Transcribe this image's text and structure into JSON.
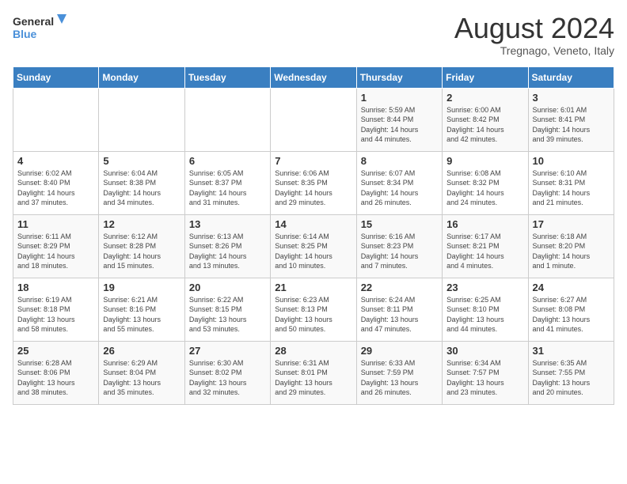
{
  "logo": {
    "line1": "General",
    "line2": "Blue"
  },
  "title": "August 2024",
  "subtitle": "Tregnago, Veneto, Italy",
  "days_of_week": [
    "Sunday",
    "Monday",
    "Tuesday",
    "Wednesday",
    "Thursday",
    "Friday",
    "Saturday"
  ],
  "weeks": [
    [
      {
        "day": "",
        "info": ""
      },
      {
        "day": "",
        "info": ""
      },
      {
        "day": "",
        "info": ""
      },
      {
        "day": "",
        "info": ""
      },
      {
        "day": "1",
        "info": "Sunrise: 5:59 AM\nSunset: 8:44 PM\nDaylight: 14 hours\nand 44 minutes."
      },
      {
        "day": "2",
        "info": "Sunrise: 6:00 AM\nSunset: 8:42 PM\nDaylight: 14 hours\nand 42 minutes."
      },
      {
        "day": "3",
        "info": "Sunrise: 6:01 AM\nSunset: 8:41 PM\nDaylight: 14 hours\nand 39 minutes."
      }
    ],
    [
      {
        "day": "4",
        "info": "Sunrise: 6:02 AM\nSunset: 8:40 PM\nDaylight: 14 hours\nand 37 minutes."
      },
      {
        "day": "5",
        "info": "Sunrise: 6:04 AM\nSunset: 8:38 PM\nDaylight: 14 hours\nand 34 minutes."
      },
      {
        "day": "6",
        "info": "Sunrise: 6:05 AM\nSunset: 8:37 PM\nDaylight: 14 hours\nand 31 minutes."
      },
      {
        "day": "7",
        "info": "Sunrise: 6:06 AM\nSunset: 8:35 PM\nDaylight: 14 hours\nand 29 minutes."
      },
      {
        "day": "8",
        "info": "Sunrise: 6:07 AM\nSunset: 8:34 PM\nDaylight: 14 hours\nand 26 minutes."
      },
      {
        "day": "9",
        "info": "Sunrise: 6:08 AM\nSunset: 8:32 PM\nDaylight: 14 hours\nand 24 minutes."
      },
      {
        "day": "10",
        "info": "Sunrise: 6:10 AM\nSunset: 8:31 PM\nDaylight: 14 hours\nand 21 minutes."
      }
    ],
    [
      {
        "day": "11",
        "info": "Sunrise: 6:11 AM\nSunset: 8:29 PM\nDaylight: 14 hours\nand 18 minutes."
      },
      {
        "day": "12",
        "info": "Sunrise: 6:12 AM\nSunset: 8:28 PM\nDaylight: 14 hours\nand 15 minutes."
      },
      {
        "day": "13",
        "info": "Sunrise: 6:13 AM\nSunset: 8:26 PM\nDaylight: 14 hours\nand 13 minutes."
      },
      {
        "day": "14",
        "info": "Sunrise: 6:14 AM\nSunset: 8:25 PM\nDaylight: 14 hours\nand 10 minutes."
      },
      {
        "day": "15",
        "info": "Sunrise: 6:16 AM\nSunset: 8:23 PM\nDaylight: 14 hours\nand 7 minutes."
      },
      {
        "day": "16",
        "info": "Sunrise: 6:17 AM\nSunset: 8:21 PM\nDaylight: 14 hours\nand 4 minutes."
      },
      {
        "day": "17",
        "info": "Sunrise: 6:18 AM\nSunset: 8:20 PM\nDaylight: 14 hours\nand 1 minute."
      }
    ],
    [
      {
        "day": "18",
        "info": "Sunrise: 6:19 AM\nSunset: 8:18 PM\nDaylight: 13 hours\nand 58 minutes."
      },
      {
        "day": "19",
        "info": "Sunrise: 6:21 AM\nSunset: 8:16 PM\nDaylight: 13 hours\nand 55 minutes."
      },
      {
        "day": "20",
        "info": "Sunrise: 6:22 AM\nSunset: 8:15 PM\nDaylight: 13 hours\nand 53 minutes."
      },
      {
        "day": "21",
        "info": "Sunrise: 6:23 AM\nSunset: 8:13 PM\nDaylight: 13 hours\nand 50 minutes."
      },
      {
        "day": "22",
        "info": "Sunrise: 6:24 AM\nSunset: 8:11 PM\nDaylight: 13 hours\nand 47 minutes."
      },
      {
        "day": "23",
        "info": "Sunrise: 6:25 AM\nSunset: 8:10 PM\nDaylight: 13 hours\nand 44 minutes."
      },
      {
        "day": "24",
        "info": "Sunrise: 6:27 AM\nSunset: 8:08 PM\nDaylight: 13 hours\nand 41 minutes."
      }
    ],
    [
      {
        "day": "25",
        "info": "Sunrise: 6:28 AM\nSunset: 8:06 PM\nDaylight: 13 hours\nand 38 minutes."
      },
      {
        "day": "26",
        "info": "Sunrise: 6:29 AM\nSunset: 8:04 PM\nDaylight: 13 hours\nand 35 minutes."
      },
      {
        "day": "27",
        "info": "Sunrise: 6:30 AM\nSunset: 8:02 PM\nDaylight: 13 hours\nand 32 minutes."
      },
      {
        "day": "28",
        "info": "Sunrise: 6:31 AM\nSunset: 8:01 PM\nDaylight: 13 hours\nand 29 minutes."
      },
      {
        "day": "29",
        "info": "Sunrise: 6:33 AM\nSunset: 7:59 PM\nDaylight: 13 hours\nand 26 minutes."
      },
      {
        "day": "30",
        "info": "Sunrise: 6:34 AM\nSunset: 7:57 PM\nDaylight: 13 hours\nand 23 minutes."
      },
      {
        "day": "31",
        "info": "Sunrise: 6:35 AM\nSunset: 7:55 PM\nDaylight: 13 hours\nand 20 minutes."
      }
    ]
  ]
}
